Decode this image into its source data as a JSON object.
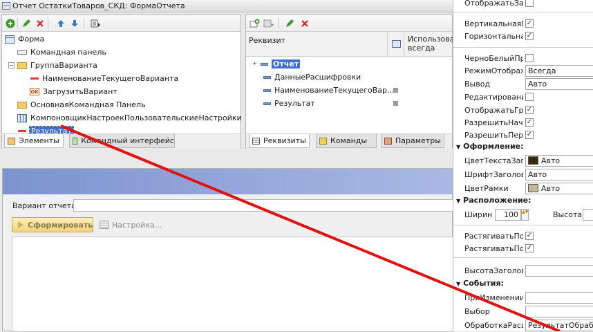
{
  "window": {
    "title": "Отчет ОстаткиТоваров_СКД: ФормаОтчета"
  },
  "elements_panel": {
    "tree": [
      {
        "label": "Форма",
        "icon": "form-icon",
        "level": 0
      },
      {
        "label": "Командная панель",
        "icon": "command-panel-icon",
        "level": 1
      },
      {
        "label": "ГруппаВарианта",
        "icon": "folder-icon",
        "level": 1,
        "expanded": true
      },
      {
        "label": "НаименованиеТекущегоВарианта",
        "icon": "field-icon",
        "level": 2
      },
      {
        "label": "ЗагрузитьВариант",
        "icon": "button-icon",
        "level": 2,
        "badge": "OK"
      },
      {
        "label": "ОсновнаяКомандная Панель",
        "icon": "folder-icon",
        "level": 1
      },
      {
        "label": "КомпоновщикНастроекПользовательскиеНастройки",
        "icon": "table-icon",
        "level": 1
      },
      {
        "label": "Результат",
        "icon": "field-icon",
        "level": 1,
        "selected": true
      }
    ],
    "tabs": [
      "Элементы",
      "Командный интерфейс"
    ]
  },
  "attributes_panel": {
    "col_attribute": "Реквизит",
    "col_use": "Использовать всегда",
    "rows": [
      {
        "label": "Отчет",
        "selected": true
      },
      {
        "label": "ДанныеРасшифровки"
      },
      {
        "label": "НаименованиеТекущегоВар..."
      },
      {
        "label": "Результат"
      }
    ],
    "tabs": [
      "Реквизиты",
      "Команды",
      "Параметры"
    ]
  },
  "preview": {
    "variant_label": "Вариант отчета:",
    "generate_button": "Сформировать",
    "settings_button": "Настройка..."
  },
  "properties": {
    "rows": [
      {
        "label": "ОтображатьЗагс",
        "type": "check",
        "checked": false
      },
      {
        "label": "ВертикальнаяПс",
        "type": "check",
        "checked": true
      },
      {
        "label": "ГоризонтальнаяП",
        "type": "check",
        "checked": true
      },
      {
        "label": "ЧерноБелыйПро",
        "type": "check",
        "checked": false
      },
      {
        "label": "РежимОтображе",
        "type": "field",
        "value": "Всегда"
      },
      {
        "label": "Вывод",
        "type": "field",
        "value": "Авто"
      },
      {
        "label": "Редактирование",
        "type": "check",
        "checked": false
      },
      {
        "label": "ОтображатьГрупп",
        "type": "check",
        "checked": true
      },
      {
        "label": "РазрешитьНачал",
        "type": "check",
        "checked": true
      },
      {
        "label": "РазрешитьПерет",
        "type": "check",
        "checked": true
      }
    ],
    "section_design": "Оформление:",
    "design_rows": [
      {
        "label": "ЦветТекстаЗаго",
        "value": "Авто",
        "swatch": "#3a2a0a"
      },
      {
        "label": "ШрифтЗаголовка",
        "value": "Авто"
      },
      {
        "label": "ЦветРамки",
        "value": "Авто",
        "swatch": "#c3b595"
      }
    ],
    "section_position": "Расположение:",
    "width_label": "Ширина",
    "width_value": "100",
    "height_label": "Высота",
    "stretch_rows": [
      {
        "label": "РастягиватьПоГ",
        "checked": true
      },
      {
        "label": "РастягиватьПоВ",
        "checked": true
      }
    ],
    "header_height_label": "ВысотаЗаголовк",
    "section_events": "События:",
    "event_rows": [
      {
        "label": "ПриИзменении",
        "value": ""
      },
      {
        "label": "Выбор",
        "value": ""
      },
      {
        "label": "ОбработкаРасш",
        "value": "РезультатОбработ"
      }
    ]
  },
  "colors": {
    "selection": "#3d6fd1",
    "preview_header": "#8fa4d8",
    "arrow": "#e31212"
  }
}
